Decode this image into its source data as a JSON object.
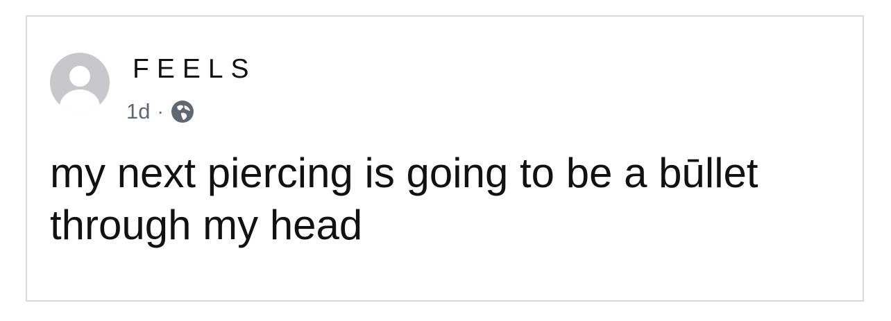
{
  "post": {
    "author": "FEELS",
    "timestamp": "1d",
    "separator": "·",
    "privacy_icon": "globe-icon",
    "avatar_icon": "default-avatar-icon",
    "text": "my next piercing is going to be a būllet through my head"
  }
}
